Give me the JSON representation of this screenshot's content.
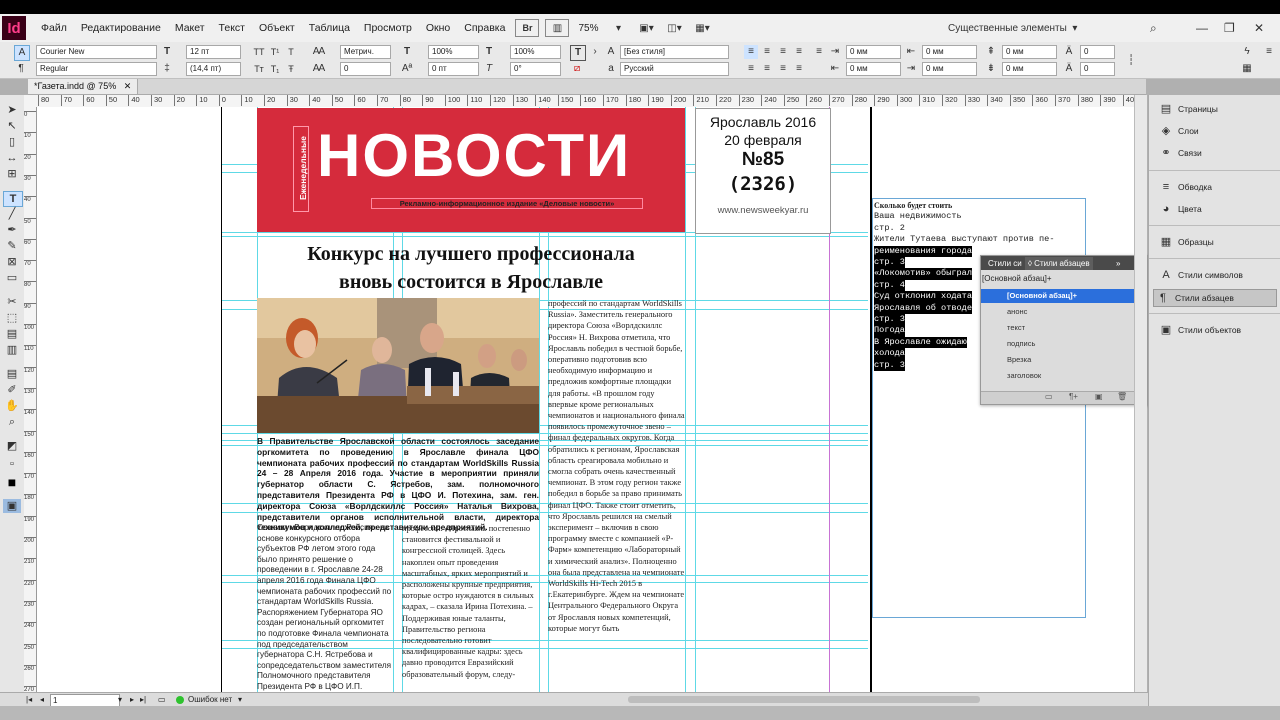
{
  "app": {
    "icon_text": "Id"
  },
  "menubar": {
    "items": [
      "Файл",
      "Редактирование",
      "Макет",
      "Текст",
      "Объект",
      "Таблица",
      "Просмотр",
      "Окно",
      "Справка"
    ],
    "br_label": "Br",
    "zoom": "75%",
    "workspace": "Существенные элементы"
  },
  "control": {
    "font_family": "Courier New",
    "font_style": "Regular",
    "font_size": "12 пт",
    "leading": "(14,4 пт)",
    "kerning": "Метрич.",
    "tracking": "0",
    "vscale": "100%",
    "hscale": "100%",
    "baseline": "0 пт",
    "skew": "0°",
    "char_style": "[Без стиля]",
    "language": "Русский",
    "indent_left": "0 мм",
    "indent_right": "0 мм",
    "indent_first": "0 мм",
    "indent_last": "0 мм",
    "space_before": "0 мм",
    "space_after": "0 мм",
    "space_before2": "0 мм",
    "space_after2": "0 мм",
    "drop_lines": "0",
    "drop_chars": "0"
  },
  "document": {
    "tab_title": "*Газета.indd @ 75%"
  },
  "ruler": {
    "h_ticks": [
      "80",
      "70",
      "60",
      "50",
      "40",
      "30",
      "20",
      "10",
      "0",
      "10",
      "20",
      "30",
      "40",
      "50",
      "60",
      "70",
      "80",
      "90",
      "100",
      "110",
      "120",
      "130",
      "140",
      "150",
      "160",
      "170",
      "180",
      "190",
      "200",
      "210",
      "220",
      "230",
      "240",
      "250",
      "260",
      "270",
      "280",
      "290",
      "300",
      "310",
      "320",
      "330",
      "340",
      "350",
      "360",
      "370",
      "380",
      "390",
      "400"
    ],
    "v_ticks": [
      "0",
      "10",
      "20",
      "30",
      "40",
      "50",
      "60",
      "70",
      "80",
      "90",
      "100",
      "110",
      "120",
      "130",
      "140",
      "150",
      "160",
      "170",
      "180",
      "190",
      "200",
      "210",
      "220",
      "230",
      "240",
      "250",
      "260",
      "270"
    ]
  },
  "masthead": {
    "title": "НОВОСТИ",
    "side_label": "Еженедельные",
    "subtitle": "Рекламно-информационное издание «Деловые новости»"
  },
  "issue": {
    "city_year": "Ярославль 2016",
    "date": "20 февраля",
    "number": "№85",
    "total": "(2326)",
    "site": "www.newsweekyar.ru"
  },
  "article": {
    "headline_line1": "Конкурс на лучшего профессионала",
    "headline_line2": "вновь состоится в Ярославле",
    "lead": "В Правительстве Ярославской области состоялось заседание оргкомитета по проведению в Ярославле финала ЦФО чемпионата рабочих профессий по стандартам WorldSkills Russia 24 – 28 Апреля 2016 года. Участие в мероприятии приняли губернатор области С. Ястребов, зам. полномочного представителя Президента РФ в ЦФО И. Потехина, зам. ген. директора Союза «Ворлдскиллс Россия» Наталья Вихрова, представители органов исполнительной власти, директора техникумов и колледжей, представители предприятий.",
    "colA": "Союзом «Ворлдскиллс Россия» на основе конкурсного отбора субъектов РФ летом этого года было принято решение о проведении в г. Ярославле 24-28 апреля 2016 года Финала ЦФО чемпионата рабочих профессий по стандартам WorldSkills Russia. Распоряжением Губернатора ЯО создан региональный оргкомитет по подготовке Финала чемпионата под председательством губернатора С.Н. Ястребова и сопредседательством заместителя Полномочного представителя Президента РФ в ЦФО И.П. Потехиной. Участников будет составлять в",
    "colB": "профессий. «Ярославль постепенно становится фестивальной и конгрессной столицей. Здесь накоплен опыт проведения масштабных, ярких мероприятий и расположены крупные предприятия, которые остро нуждаются в сильных кадрах, – сказала Ирина Потехина. – Поддерживая юные таланты, Правительство региона последовательно готовит квалифицированные кадры: здесь давно проводится Евразийский образовательный форум, следу-",
    "colC": "профессий по стандартам WorldSkills Russia». Заместитель генерального директора Союза «Ворлдскиллс Россия» Н. Вихрова отметила, что Ярославль победил в честной борьбе, оперативно подготовив всю необходимую информацию и предложив комфортные площадки для работы. «В прошлом году впервые кроме региональных чемпионатов и национального финала появилось промежуточное звено – финал федеральных округов. Когда обратились к регионам, Ярославская область среагировала мобильно и смогла собрать очень качественный чемпионат. В этом году регион также победил в борьбе за право принимать финал ЦФО. Также стоит отметить, что Ярославль решился на смелый эксперимент – включив в свою программу вместе с компанией «Р-Фарм» компетенцию «Лабораторный и химический анализ». Полноценно она была представлена на чемпионате WorldSkills Hi-Tech 2015 в г.Екатеринбурге. Ждем на чемпионате Центрального Федерального Округа от Ярославля новых компетенций, которые могут быть"
  },
  "story": {
    "lines": [
      {
        "text": "Сколько будет стоить",
        "hl": false
      },
      {
        "text": "Ваша недвижимость",
        "hl": false
      },
      {
        "text": "стр. 2",
        "hl": false
      },
      {
        "text": "Жители Тутаева выступают против пе-",
        "hl": false
      },
      {
        "text": "реименования города",
        "hl": true
      },
      {
        "text": "стр. 3",
        "hl": true
      },
      {
        "text": "«Локомотив» обыграл",
        "hl": true
      },
      {
        "text": "стр. 4",
        "hl": true
      },
      {
        "text": "Суд отклонил ходата",
        "hl": true
      },
      {
        "text": "Ярославля об отводе",
        "hl": true
      },
      {
        "text": "стр. 3",
        "hl": true
      },
      {
        "text": "Погода",
        "hl": true
      },
      {
        "text": "В Ярославле ожидаю",
        "hl": true
      },
      {
        "text": "холода",
        "hl": true
      },
      {
        "text": "стр. 3",
        "hl": true
      }
    ]
  },
  "para_styles_panel": {
    "tab1": "Стили си",
    "tab2": "◊ Стили абзацев",
    "current": "[Основной абзац]+",
    "rows": [
      {
        "label": "[Основной абзац]+",
        "selected": true
      },
      {
        "label": "анонс",
        "selected": false
      },
      {
        "label": "текст",
        "selected": false
      },
      {
        "label": "подпись",
        "selected": false
      },
      {
        "label": "Врезка",
        "selected": false
      },
      {
        "label": "заголовок",
        "selected": false
      }
    ]
  },
  "dock": {
    "items": [
      {
        "label": "Страницы",
        "icon": "pages-icon",
        "glyph": "▤"
      },
      {
        "label": "Слои",
        "icon": "layers-icon",
        "glyph": "◈"
      },
      {
        "label": "Связи",
        "icon": "links-icon",
        "glyph": "⚭"
      },
      {
        "label": "Обводка",
        "icon": "stroke-icon",
        "glyph": "≡"
      },
      {
        "label": "Цвета",
        "icon": "swatches-icon",
        "glyph": "◕"
      },
      {
        "label": "Образцы",
        "icon": "samples-icon",
        "glyph": "▦"
      },
      {
        "label": "Стили символов",
        "icon": "char-styles-icon",
        "glyph": "A"
      },
      {
        "label": "Стили абзацев",
        "icon": "para-styles-icon",
        "glyph": "¶"
      },
      {
        "label": "Стили объектов",
        "icon": "object-styles-icon",
        "glyph": "▣"
      }
    ]
  },
  "status": {
    "page": "1",
    "preflight": "Ошибок нет"
  },
  "colors": {
    "masthead_red": "#d52b3c",
    "guide_cyan": "#5ed9e6",
    "selection_blue": "#2b6fdc"
  }
}
